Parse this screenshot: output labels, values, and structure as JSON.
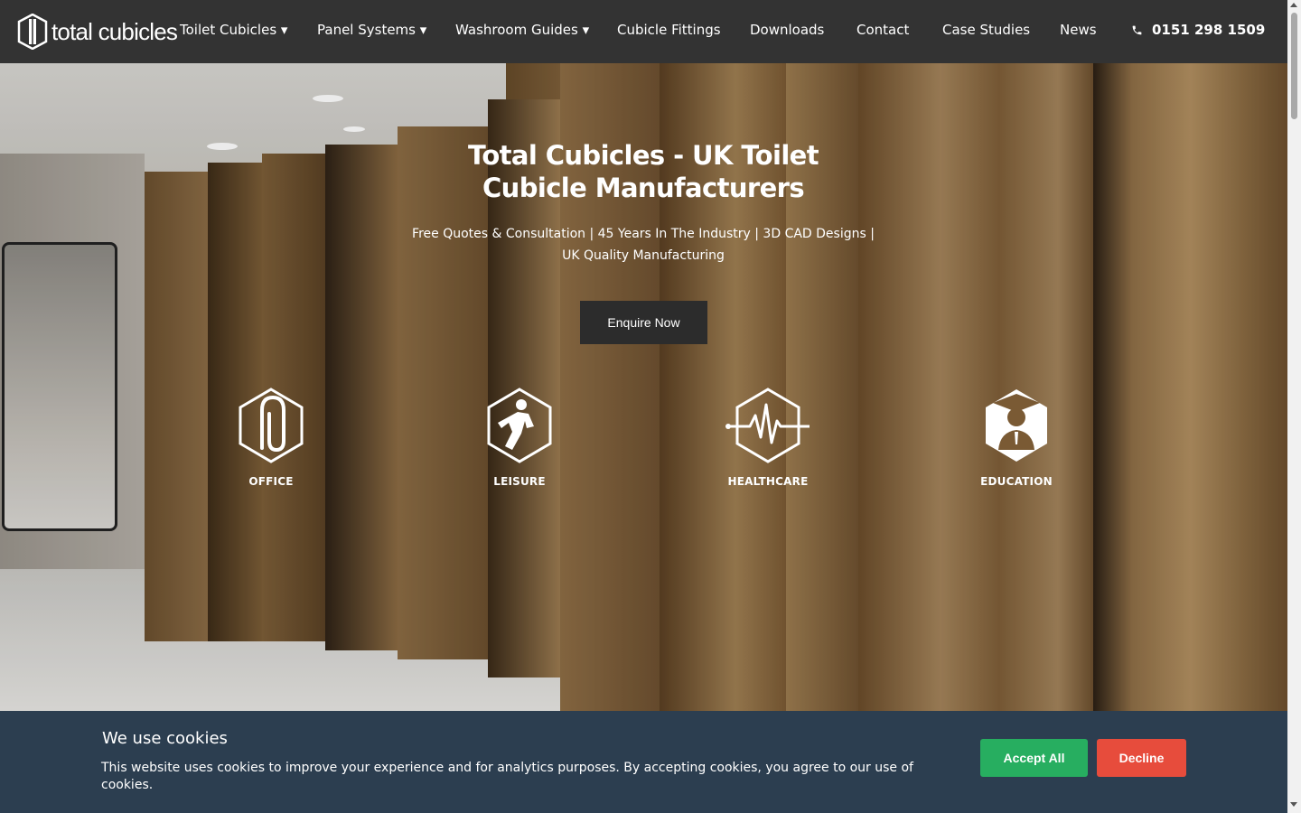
{
  "brand": {
    "name": "total cubicles"
  },
  "nav": {
    "items": [
      {
        "label": "Toilet Cubicles ▾"
      },
      {
        "label": "Panel Systems ▾"
      },
      {
        "label": "Washroom Guides ▾"
      },
      {
        "label": "Cubicle Fittings"
      },
      {
        "label": "Downloads"
      },
      {
        "label": "Contact"
      },
      {
        "label": "Case Studies"
      },
      {
        "label": "News"
      }
    ],
    "phone": {
      "icon": "phone-icon",
      "number": "0151 298 1509"
    }
  },
  "hero": {
    "title": "Total Cubicles - UK Toilet Cubicle Manufacturers",
    "subtitle": "Free Quotes & Consultation | 45 Years In The Industry | 3D CAD Designs | UK Quality Manufacturing",
    "cta": "Enquire Now",
    "sectors": [
      {
        "label": "OFFICE",
        "icon": "paperclip-icon"
      },
      {
        "label": "LEISURE",
        "icon": "athlete-icon"
      },
      {
        "label": "HEALTHCARE",
        "icon": "heartbeat-icon"
      },
      {
        "label": "EDUCATION",
        "icon": "graduate-icon"
      }
    ]
  },
  "cookie": {
    "title": "We use cookies",
    "text": "This website uses cookies to improve your experience and for analytics purposes. By accepting cookies, you agree to our use of cookies.",
    "accept": "Accept All",
    "decline": "Decline",
    "colors": {
      "banner": "#2c3e50",
      "accept": "#27ae60",
      "decline": "#e74c3c"
    }
  }
}
